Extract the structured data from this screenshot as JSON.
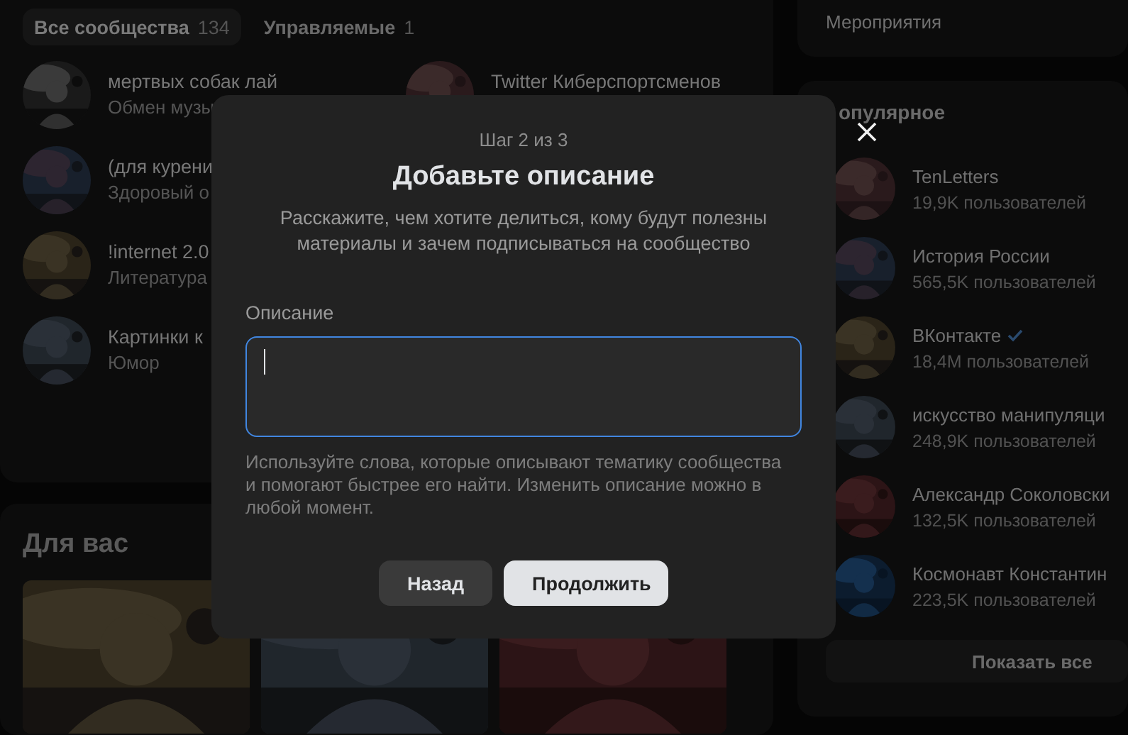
{
  "background": {
    "tabs": [
      {
        "label": "Все сообщества",
        "count": "134",
        "selected": true
      },
      {
        "label": "Управляемые",
        "count": "1",
        "selected": false
      }
    ],
    "communities": [
      {
        "name": "мертвых собак лай",
        "subtitle": "Обмен музы"
      },
      {
        "name": "Twitter Киберспортсменов"
      },
      {
        "name": "(для курени",
        "subtitle": "Здоровый о"
      },
      {
        "name": "!internet 2.0",
        "subtitle": "Литература"
      },
      {
        "name": "Картинки к",
        "subtitle": "Юмор"
      }
    ],
    "for_you": {
      "title": "Для вас"
    },
    "events": {
      "label": "Мероприятия"
    },
    "popular": {
      "title": "опулярное",
      "items": [
        {
          "name": "TenLetters",
          "members": "19,9K пользователей",
          "verified": false
        },
        {
          "name": "История России",
          "members": "565,5K пользователей",
          "verified": false
        },
        {
          "name": "ВКонтакте",
          "members": "18,4M пользователей",
          "verified": true
        },
        {
          "name": "искусство манипуляци",
          "members": "248,9K пользователей",
          "verified": false
        },
        {
          "name": "Александр Соколовски",
          "members": "132,5K пользователей",
          "verified": false
        },
        {
          "name": "Космонавт Константин",
          "members": "223,5K пользователей",
          "verified": false
        }
      ],
      "show_all": "Показать все"
    }
  },
  "dialog": {
    "step": "Шаг 2 из 3",
    "title": "Добавьте описание",
    "description": "Расскажите, чем хотите делиться, кому будут полезны материалы и зачем подписываться на сообщество",
    "field_label": "Описание",
    "field_focused": true,
    "hint": "Используйте слова, которые описывают тематику сообщества и помогают быстрее его найти. Изменить описание можно в любой момент.",
    "buttons": [
      {
        "label": "Назад",
        "kind": "secondary"
      },
      {
        "label": "Продолжить",
        "kind": "primary"
      }
    ]
  }
}
